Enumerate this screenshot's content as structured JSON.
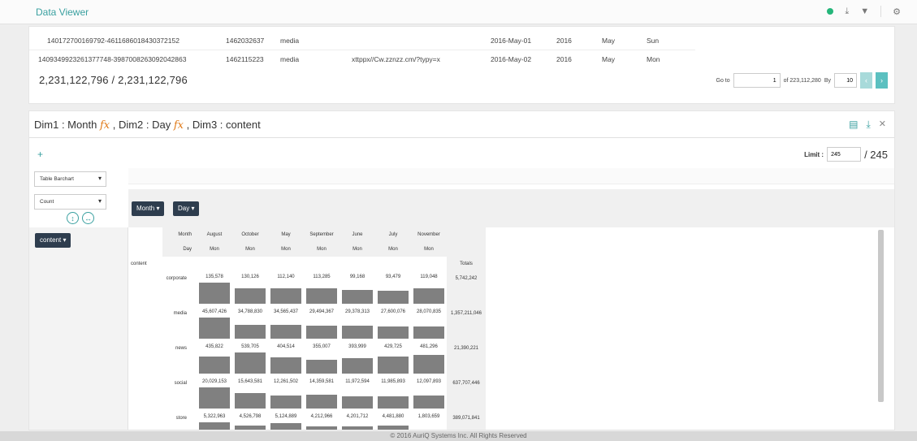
{
  "app": {
    "title": "Data Viewer"
  },
  "data_rows": [
    {
      "id": "140172700169792-4611686018430372152",
      "num": "1462032637",
      "category": "media",
      "url": "",
      "date": "2016-May-01",
      "year": "2016",
      "month": "May",
      "day": "Sun"
    },
    {
      "id": "1409349923261377748-3987008263092042863",
      "num": "1462115223",
      "category": "media",
      "url": "xttppx//Cw.zznzz.cm/?typy=x",
      "date": "2016-May-02",
      "year": "2016",
      "month": "May",
      "day": "Mon"
    }
  ],
  "total_count": "2,231,122,796 / 2,231,122,796",
  "pager": {
    "goto_label": "Go to",
    "page_value": "1",
    "of_label": "of 223,112,280",
    "by_label": "By",
    "page_size": "10",
    "prev": "‹",
    "next": "›"
  },
  "pivot": {
    "title_dim1": "Dim1 : Month",
    "title_dim2": ", Dim2 : Day",
    "title_dim3": ", Dim3 : content",
    "fx": "fx",
    "plus": "+",
    "limit_label": "Limit :",
    "limit_value": "245",
    "limit_total": "/ 245",
    "renderer": "Table Barchart",
    "aggregator": "Count",
    "col_attrs": [
      "Month ▾",
      "Day ▾"
    ],
    "row_attr": "content ▾",
    "axis_month": "Month",
    "axis_day": "Day",
    "row_header": "content",
    "totals_label": "Totals",
    "months": [
      "August",
      "October",
      "May",
      "September",
      "June",
      "July",
      "November"
    ],
    "days": [
      "Mon",
      "Mon",
      "Mon",
      "Mon",
      "Mon",
      "Mon",
      "Mon"
    ],
    "rows": [
      {
        "label": "corporate",
        "values": [
          "135,578",
          "130,126",
          "112,140",
          "113,285",
          "99,168",
          "93,479",
          "119,048"
        ],
        "fill": [
          1.0,
          0.72,
          0.72,
          0.72,
          0.67,
          0.63,
          0.72
        ],
        "total": "5,742,242"
      },
      {
        "label": "media",
        "values": [
          "45,607,426",
          "34,788,830",
          "34,565,437",
          "29,494,367",
          "29,378,313",
          "27,600,076",
          "28,070,835"
        ],
        "fill": [
          1.0,
          0.67,
          0.67,
          0.63,
          0.63,
          0.58,
          0.58
        ],
        "total": "1,357,211,046"
      },
      {
        "label": "news",
        "values": [
          "435,822",
          "539,705",
          "404,514",
          "355,007",
          "393,999",
          "429,725",
          "481,296"
        ],
        "fill": [
          0.8,
          1.0,
          0.75,
          0.66,
          0.72,
          0.79,
          0.88
        ],
        "total": "21,390,221"
      },
      {
        "label": "social",
        "values": [
          "20,029,153",
          "15,643,581",
          "12,261,502",
          "14,359,581",
          "11,972,594",
          "11,985,893",
          "12,097,893"
        ],
        "fill": [
          1.0,
          0.72,
          0.6,
          0.66,
          0.58,
          0.58,
          0.6
        ],
        "total": "637,707,446"
      },
      {
        "label": "store",
        "values": [
          "5,322,963",
          "4,526,798",
          "5,124,889",
          "4,212,966",
          "4,201,712",
          "4,481,880",
          "1,803,659"
        ],
        "fill": [
          1.0,
          0.85,
          0.96,
          0.79,
          0.79,
          0.84,
          0.34
        ],
        "total": "389,071,841"
      }
    ]
  },
  "footer": "© 2016 AuriQ Systems Inc. All Rights Reserved"
}
